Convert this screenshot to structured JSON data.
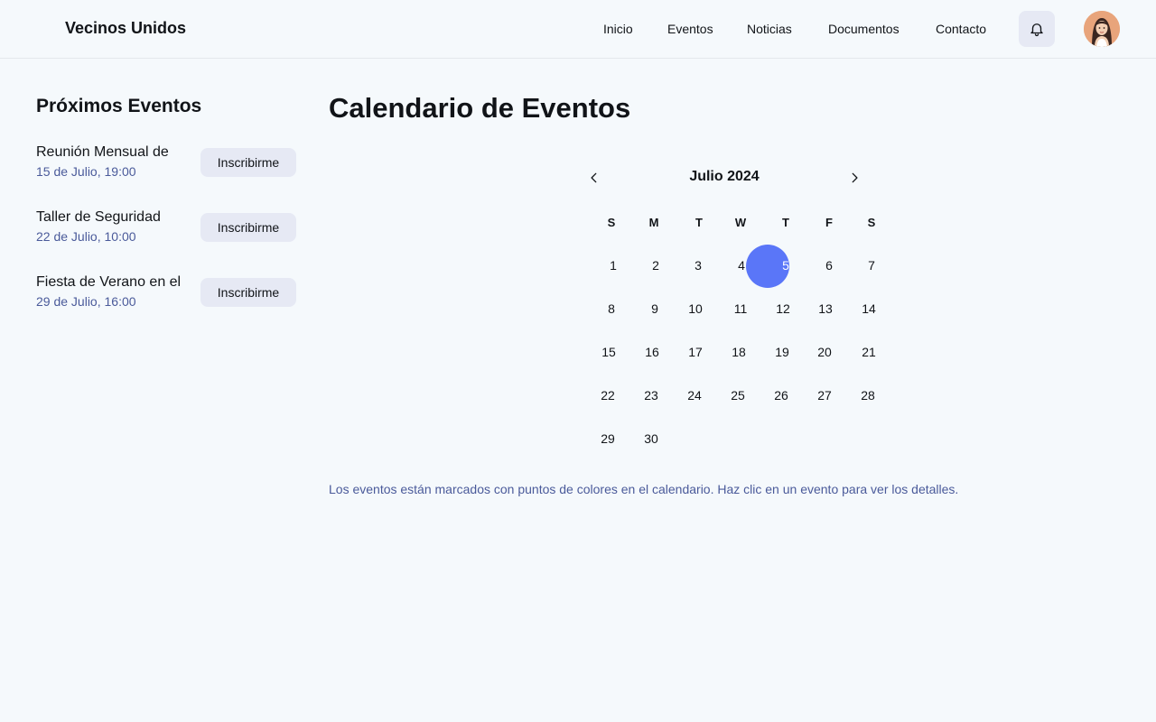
{
  "app": {
    "brand": "Vecinos Unidos"
  },
  "nav": {
    "items": [
      "Inicio",
      "Eventos",
      "Noticias",
      "Documentos",
      "Contacto"
    ]
  },
  "header": {
    "bell_icon": "bell-icon",
    "avatar_icon": "user-avatar"
  },
  "sidebar": {
    "title": "Próximos Eventos",
    "events": [
      {
        "name": "Reunión Mensual de",
        "date": "15 de Julio, 19:00",
        "button": "Inscribirme"
      },
      {
        "name": "Taller de Seguridad",
        "date": "22 de Julio, 10:00",
        "button": "Inscribirme"
      },
      {
        "name": "Fiesta de Verano en el",
        "date": "29 de Julio, 16:00",
        "button": "Inscribirme"
      }
    ]
  },
  "main": {
    "title": "Calendario de Eventos",
    "calendar": {
      "month": "Julio 2024",
      "prev_icon": "chevron-left-icon",
      "next_icon": "chevron-right-icon",
      "weekdays": [
        "S",
        "M",
        "T",
        "W",
        "T",
        "F",
        "S"
      ],
      "days": [
        [
          "1",
          "2",
          "3",
          "4",
          "5",
          "6",
          "7"
        ],
        [
          "8",
          "9",
          "10",
          "11",
          "12",
          "13",
          "14"
        ],
        [
          "15",
          "16",
          "17",
          "18",
          "19",
          "20",
          "21"
        ],
        [
          "22",
          "23",
          "24",
          "25",
          "26",
          "27",
          "28"
        ],
        [
          "29",
          "30"
        ]
      ],
      "selected_day": "5",
      "selected_color": "#5a76f8"
    },
    "legend": "Los eventos están marcados con puntos de colores en el calendario. Haz clic en un evento para ver los detalles."
  }
}
